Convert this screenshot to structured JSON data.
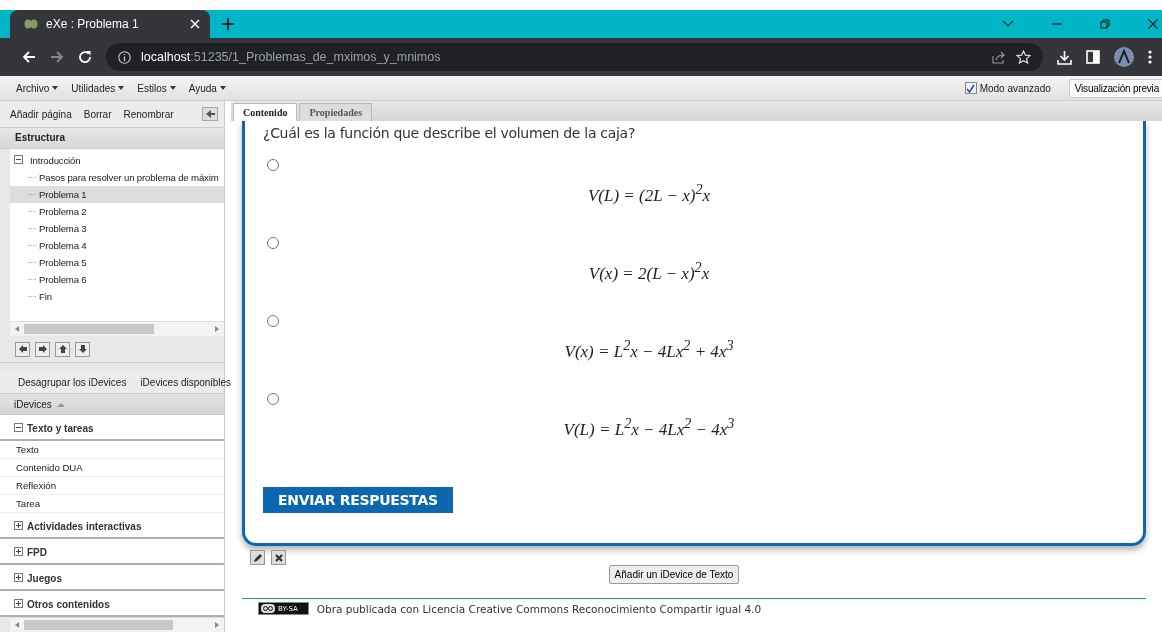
{
  "browser": {
    "tab_title": "eXe : Problema 1",
    "url_host": "localhost",
    "url_path": ":51235/1_Problemas_de_mximos_y_mnimos"
  },
  "menu": [
    "Archivo",
    "Utilidades",
    "Estilos",
    "Ayuda"
  ],
  "advanced_mode": {
    "label": "Modo avanzado",
    "checked": true
  },
  "preview_button": "Visualización previa",
  "outline_toolbar": [
    "Añadir página",
    "Borrar",
    "Renombrar"
  ],
  "structure_title": "Estructura",
  "tree": [
    {
      "label": "Introducción",
      "expanded": true,
      "selected": false,
      "children": [
        {
          "label": "Pasos para resolver un problema de máxim",
          "selected": false
        },
        {
          "label": "Problema 1",
          "selected": true
        },
        {
          "label": "Problema 2",
          "selected": false
        },
        {
          "label": "Problema 3",
          "selected": false
        },
        {
          "label": "Problema 4",
          "selected": false
        },
        {
          "label": "Problema 5",
          "selected": false
        },
        {
          "label": "Problema 6",
          "selected": false
        },
        {
          "label": "Fin",
          "selected": false
        }
      ]
    }
  ],
  "idevice_toolbar": [
    "Desagrupar los iDevices",
    "iDevices disponibles"
  ],
  "idevices_header": "iDevices",
  "idevice_groups": [
    {
      "label": "Texto y tareas",
      "expanded": true,
      "items": [
        "Texto",
        "Contenido DUA",
        "Reflexión",
        "Tarea"
      ]
    },
    {
      "label": "Actividades interactivas",
      "expanded": false
    },
    {
      "label": "FPD",
      "expanded": false
    },
    {
      "label": "Juegos",
      "expanded": false
    },
    {
      "label": "Otros contenidos",
      "expanded": false
    }
  ],
  "content_tabs": [
    {
      "label": "Contenido",
      "selected": true
    },
    {
      "label": "Propiedades",
      "selected": false
    }
  ],
  "question": "¿Cuál es la función que describe el volumen de la caja?",
  "options": [
    {
      "formula": "V(L) = (2L − x)$^{2}$x",
      "selected": false
    },
    {
      "formula": "V(x) = 2(L − x)$^{2}$x",
      "selected": false
    },
    {
      "formula": "V(x) = L$^{2}$x − 4Lx$^{2}$ + 4x$^{3}$",
      "selected": false
    },
    {
      "formula": "V(L) = L$^{2}$x − 4Lx$^{2}$ − 4x$^{3}$",
      "selected": false
    }
  ],
  "submit_button": "ENVIAR RESPUESTAS",
  "add_text_button": "Añadir un iDevice de Texto",
  "license_badge": "BY-SA",
  "license_text": "Obra publicada con Licencia Creative Commons Reconocimiento Compartir igual 4.0"
}
